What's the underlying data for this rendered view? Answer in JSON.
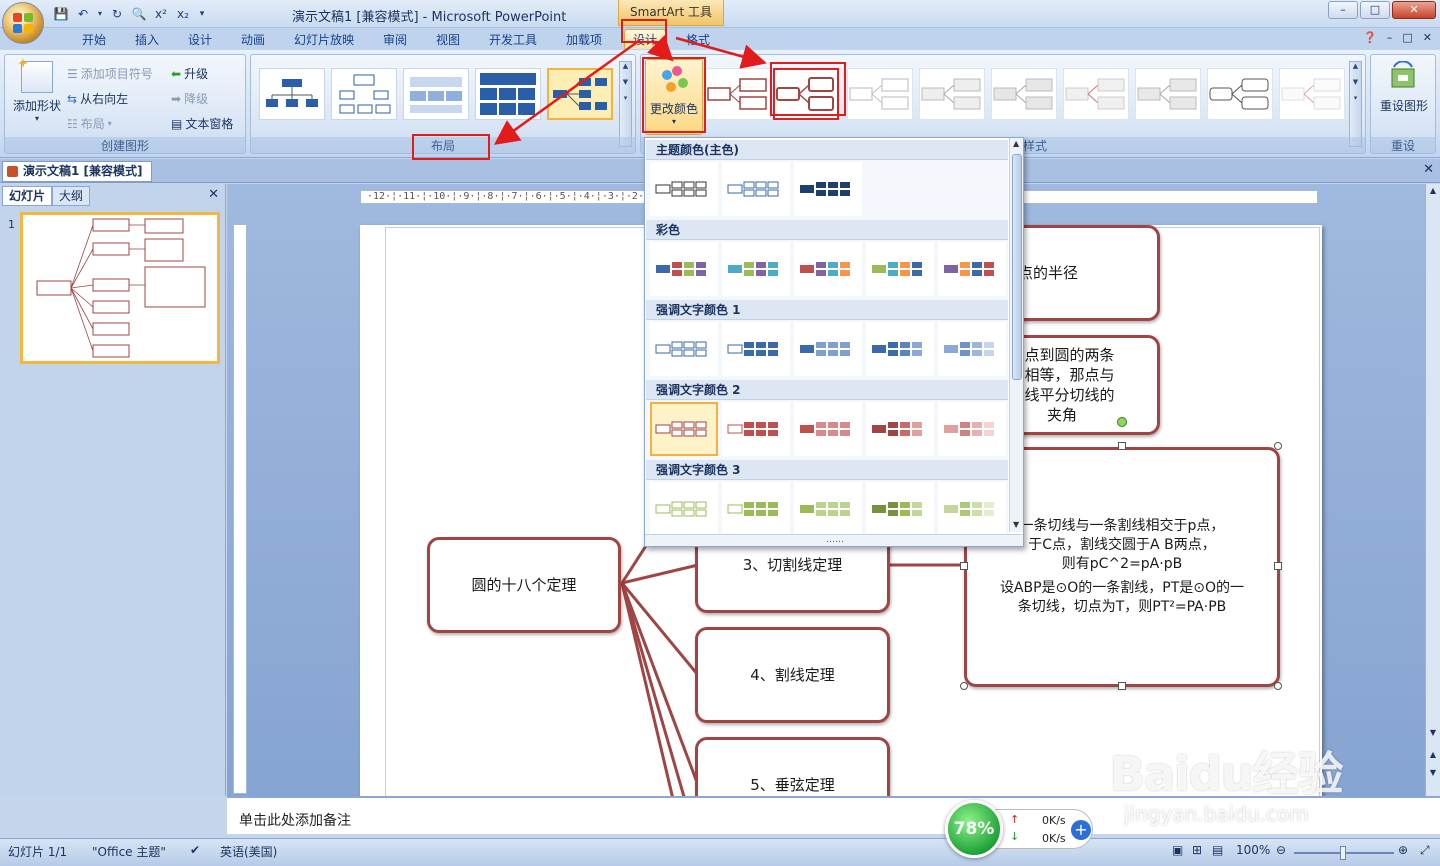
{
  "window": {
    "title": "演示文稿1 [兼容模式] - Microsoft PowerPoint",
    "contextual_tab_group": "SmartArt 工具"
  },
  "tabs": [
    "开始",
    "插入",
    "设计",
    "动画",
    "幻灯片放映",
    "审阅",
    "视图",
    "开发工具",
    "加载项",
    "设计",
    "格式"
  ],
  "ribbon": {
    "create_graphic": {
      "label": "创建图形",
      "add_shape": "添加形状",
      "add_bullet": "添加项目符号",
      "right_to_left": "从右向左",
      "layout": "布局",
      "promote": "升级",
      "demote": "降级",
      "text_pane": "文本窗格"
    },
    "layouts": {
      "label": "布局"
    },
    "styles": {
      "label": "样式",
      "visible_label": "样式",
      "change_colors": "更改颜色"
    },
    "reset": {
      "label": "重设",
      "reset_graphic": "重设图形"
    }
  },
  "document_tab": "演示文稿1 [兼容模式]",
  "left_pane": {
    "tab_slides": "幻灯片",
    "tab_outline": "大纲",
    "slide_number": "1"
  },
  "color_dropdown": {
    "sections": [
      "主题颜色(主色)",
      "彩色",
      "强调文字颜色 1",
      "强调文字颜色 2",
      "强调文字颜色 3"
    ],
    "selected": "强调文字颜色 2"
  },
  "slide": {
    "root": "圆的十八个定理",
    "items": [
      "3、切割线定理",
      "4、割线定理",
      "5、垂弦定理"
    ],
    "details": [
      "于过切点的半径",
      "一点到圆的两条\n长相等，那点与\n连线平分切线的\n夹角",
      "一条切线与一条割线相交于p点，\n于C点，割线交圆于A B两点，\n则有pC^2=pA·pB",
      "设ABP是⊙O的一条割线，PT是⊙O的一\n条切线，切点为T，则PT²=PA·PB"
    ]
  },
  "notes_placeholder": "单击此处添加备注",
  "status": {
    "slide": "幻灯片 1/1",
    "theme": "\"Office 主题\"",
    "language": "英语(美国)",
    "zoom": "100%"
  },
  "net": {
    "percent": "78%",
    "up": "0K/s",
    "down": "0K/s"
  },
  "watermark": {
    "main": "Baidu经验",
    "sub": "jingyan.baidu.com"
  },
  "colors": {
    "node_border": "#a04444",
    "accent_highlight": "#e31b1b",
    "selection": "#f3b33c"
  }
}
